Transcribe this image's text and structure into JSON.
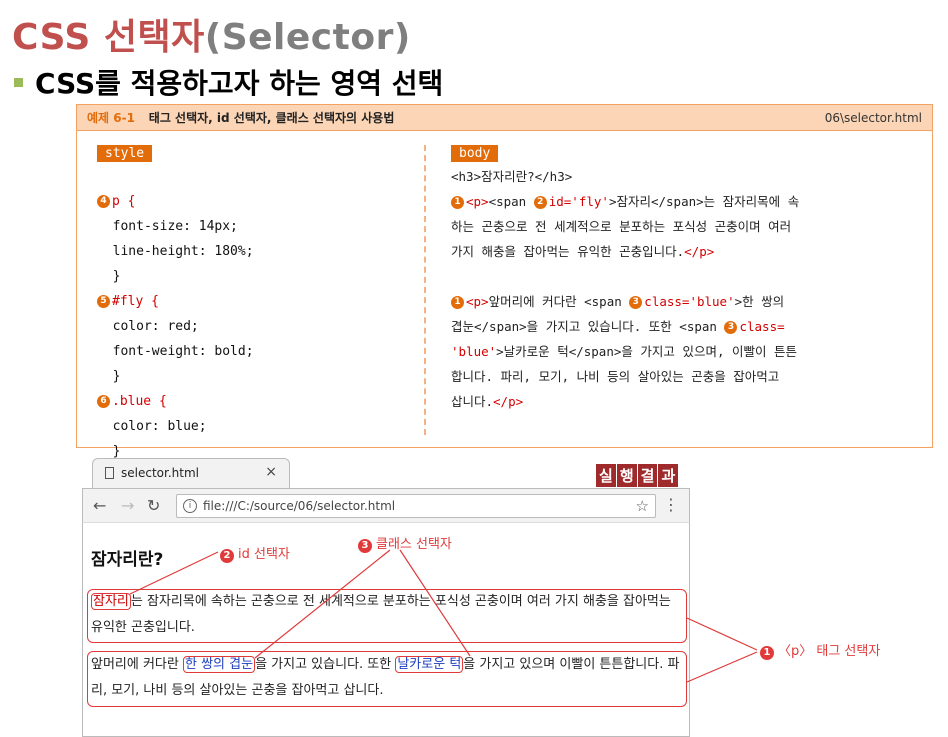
{
  "title": {
    "part1": "CSS 선택자",
    "part2": "(Selector)"
  },
  "bullet": "CSS를 적용하고자 하는 영역 선택",
  "example": {
    "number": "예제 6-1",
    "heading": "태그 선택자, id 선택자, 클래스 선택자의 사용법",
    "file": "06\\selector.html",
    "style_tag": "style",
    "body_tag": "body",
    "css": {
      "l1": "p {",
      "l2": "  font-size: 14px;",
      "l3": "  line-height: 180%;",
      "l4": "  }",
      "l5": "#fly {",
      "l6": "  color: red;",
      "l7": "  font-weight: bold;",
      "l8": "  }",
      "l9": ".blue {",
      "l10": "  color: blue;",
      "l11": "  }"
    },
    "markers": {
      "n4": "4",
      "n5": "5",
      "n6": "6",
      "n1": "1",
      "n2": "2",
      "n3": "3"
    },
    "html": {
      "h3": "<h3>잠자리란?</h3>",
      "p_open": "<p>",
      "span_open_1": "<span ",
      "id_attr": "id='fly'",
      "after_id": ">잠자리</span>는 잠자리목에 속",
      "line2": "하는 곤충으로 전 세계적으로 분포하는 포식성 곤충이며 여러",
      "line3": "가지 해충을 잡아먹는 유익한 곤충입니다.",
      "p_close": "</p>",
      "p2_a": "앞머리에 커다란 <span ",
      "class_attr": "class='blue'",
      "p2_b": ">한 쌍의",
      "p2_c": "겹눈</span>을 가지고 있습니다. 또한 <span ",
      "class_attr2": "class=",
      "p2_d": "'blue'",
      "p2_e": ">날카로운 턱</span>을 가지고 있으며, 이빨이 튼튼",
      "p2_f": "합니다. 파리, 모기, 나비 등의 살아있는 곤충을 잡아먹고",
      "p2_g": "삽니다."
    }
  },
  "browser": {
    "tab_title": "selector.html",
    "tab_close": "×",
    "url": "file:///C:/source/06/selector.html",
    "result_label": [
      "실",
      "행",
      "결",
      "과"
    ],
    "page": {
      "h3": "잠자리란?",
      "p1_highlight": "잠자리",
      "p1_rest": "는 잠자리목에 속하는 곤충으로 전 세계적으로 분포하는 포식성 곤충이며 여러 가지 해충을 잡아먹는 유익한 곤충입니다.",
      "p2_start": "앞머리에 커다란 ",
      "p2_hl1": "한 쌍의 겹눈",
      "p2_mid": "을 가지고 있습니다. 또한 ",
      "p2_hl2": "날카로운 턱",
      "p2_end": "을 가지고 있으며 이빨이 튼튼합니다. 파리, 모기, 나비 등의 살아있는 곤충을 잡아먹고 삽니다."
    }
  },
  "annotations": {
    "id_selector": "id 선택자",
    "class_selector": "클래스 선택자",
    "tag_selector": "〈p〉 태그 선택자"
  }
}
